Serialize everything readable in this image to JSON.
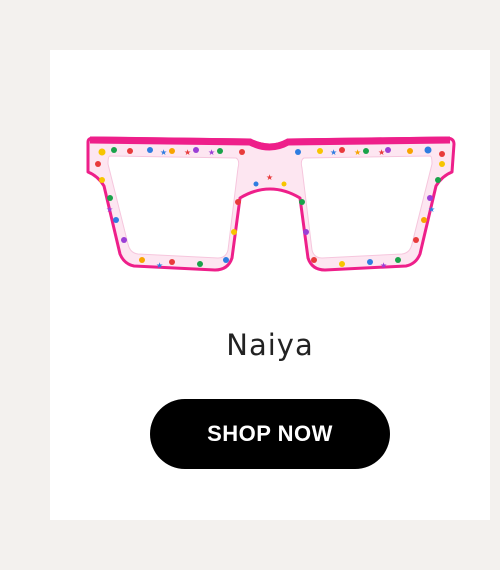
{
  "product": {
    "name": "Naiya",
    "cta_label": "SHOP NOW",
    "image_icon": "eyeglasses-icon",
    "frame_color": "#ee1f8a",
    "temple_color": "#ff3d9a"
  },
  "colors": {
    "page_background": "#f3f1ee",
    "card_background": "#ffffff",
    "button_background": "#000000",
    "button_text": "#ffffff",
    "name_text": "#222222"
  }
}
